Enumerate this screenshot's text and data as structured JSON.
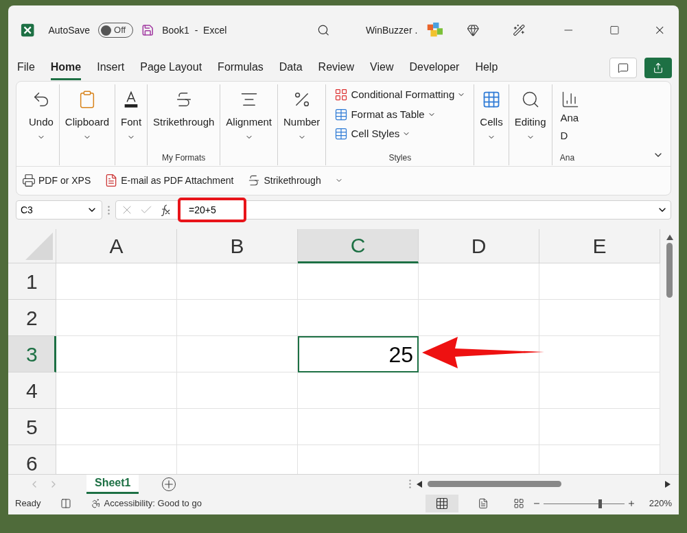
{
  "title_bar": {
    "autosave_label": "AutoSave",
    "autosave": {
      "label": "Off",
      "on": false
    },
    "document": "Book1  -  Excel",
    "account": "WinBuzzer ."
  },
  "menu_tabs": [
    {
      "label": "File",
      "selected": false
    },
    {
      "label": "Home",
      "selected": true
    },
    {
      "label": "Insert",
      "selected": false
    },
    {
      "label": "Page Layout",
      "selected": false
    },
    {
      "label": "Formulas",
      "selected": false
    },
    {
      "label": "Data",
      "selected": false
    },
    {
      "label": "Review",
      "selected": false
    },
    {
      "label": "View",
      "selected": false
    },
    {
      "label": "Developer",
      "selected": false
    },
    {
      "label": "Help",
      "selected": false
    }
  ],
  "ribbon": {
    "groups": [
      {
        "kind": "big",
        "label": "Undo"
      },
      {
        "kind": "big",
        "label": "Clipboard"
      },
      {
        "kind": "big",
        "label": "Font"
      },
      {
        "kind": "big",
        "label": "Strikethrough",
        "group_label": "My Formats"
      },
      {
        "kind": "big",
        "label": "Alignment"
      },
      {
        "kind": "big",
        "label": "Number"
      },
      {
        "kind": "list",
        "group_label": "Styles",
        "items": [
          {
            "label": "Conditional Formatting"
          },
          {
            "label": "Format as Table"
          },
          {
            "label": "Cell Styles"
          }
        ]
      },
      {
        "kind": "big",
        "label": "Cells"
      },
      {
        "kind": "big",
        "label": "Editing"
      },
      {
        "kind": "cut",
        "lines": [
          "Ana",
          "D"
        ],
        "group_label": "Ana"
      }
    ]
  },
  "quick_access": [
    {
      "label": "PDF or XPS"
    },
    {
      "label": "E-mail as PDF Attachment"
    },
    {
      "label": "Strikethrough"
    }
  ],
  "formula_bar": {
    "name_box": "C3",
    "formula": "=20+5"
  },
  "grid": {
    "columns": [
      {
        "label": "A",
        "selected": false
      },
      {
        "label": "B",
        "selected": false
      },
      {
        "label": "C",
        "selected": true
      },
      {
        "label": "D",
        "selected": false
      },
      {
        "label": "E",
        "selected": false
      }
    ],
    "rows": [
      {
        "label": "1",
        "selected": false,
        "cells": [
          {
            "selected": false
          },
          {
            "selected": false
          },
          {
            "selected": false
          },
          {
            "selected": false
          },
          {
            "selected": false
          }
        ]
      },
      {
        "label": "2",
        "selected": false,
        "cells": [
          {
            "selected": false
          },
          {
            "selected": false
          },
          {
            "selected": false
          },
          {
            "selected": false
          },
          {
            "selected": false
          }
        ]
      },
      {
        "label": "3",
        "selected": true,
        "cells": [
          {
            "selected": false
          },
          {
            "selected": false
          },
          {
            "selected": true,
            "value": "25"
          },
          {
            "selected": false
          },
          {
            "selected": false
          }
        ]
      },
      {
        "label": "4",
        "selected": false,
        "cells": [
          {
            "selected": false
          },
          {
            "selected": false
          },
          {
            "selected": false
          },
          {
            "selected": false
          },
          {
            "selected": false
          }
        ]
      },
      {
        "label": "5",
        "selected": false,
        "cells": [
          {
            "selected": false
          },
          {
            "selected": false
          },
          {
            "selected": false
          },
          {
            "selected": false
          },
          {
            "selected": false
          }
        ]
      },
      {
        "label": "6",
        "selected": false,
        "cells": [
          {
            "selected": false
          },
          {
            "selected": false
          },
          {
            "selected": false
          },
          {
            "selected": false
          },
          {
            "selected": false
          }
        ]
      }
    ]
  },
  "sheet_tabs": [
    {
      "label": "Sheet1",
      "selected": true
    }
  ],
  "status_bar": {
    "status": "Ready",
    "accessibility": "Accessibility: Good to go",
    "zoom": "220%",
    "zoom_slider": {
      "level": 0.7
    }
  }
}
